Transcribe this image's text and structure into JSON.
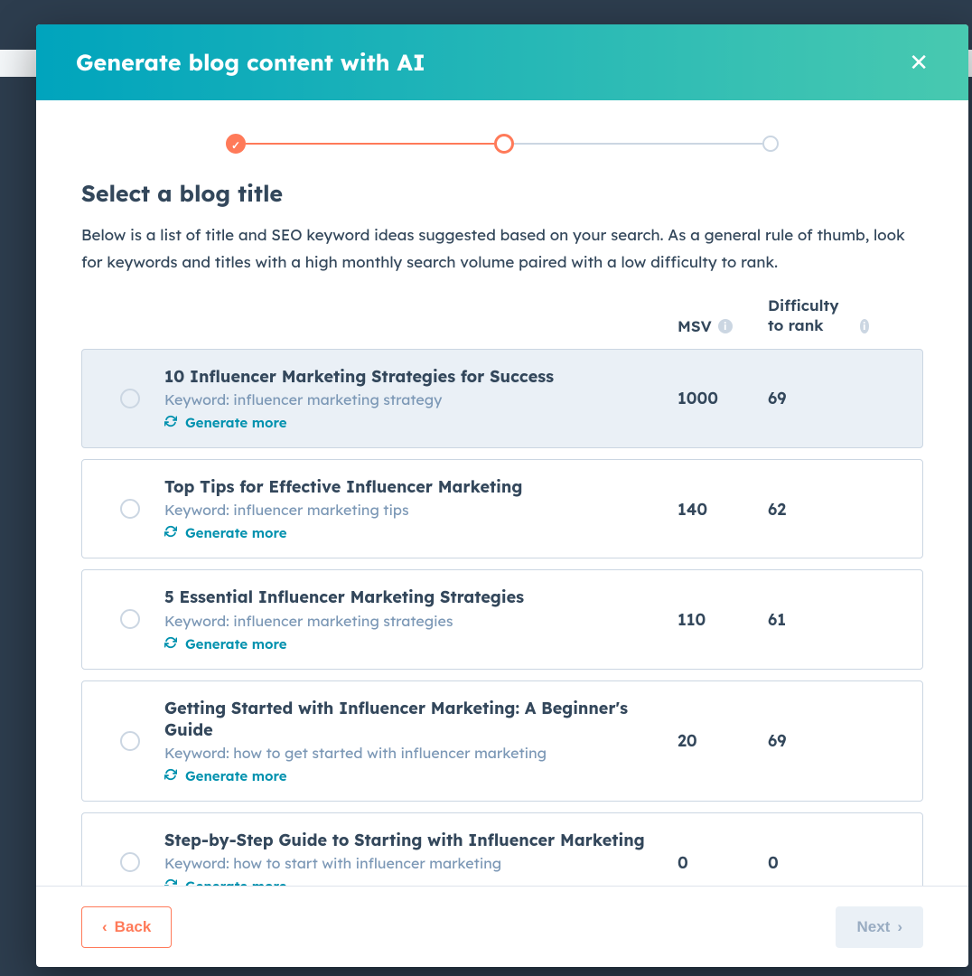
{
  "modal": {
    "title": "Generate blog content with AI",
    "close_icon": "✕"
  },
  "stepper": {
    "completed_check": "✓"
  },
  "section": {
    "title": "Select a blog title",
    "description": "Below is a list of title and SEO keyword ideas suggested based on your search. As a general rule of thumb, look for keywords and titles with a high monthly search volume paired with a low difficulty to rank."
  },
  "headers": {
    "msv": "MSV",
    "difficulty": "Difficulty to rank",
    "info_glyph": "i"
  },
  "keyword_prefix": "Keyword: ",
  "generate_more_label": "Generate more",
  "rows": [
    {
      "title": "10 Influencer Marketing Strategies for Success",
      "keyword": "influencer marketing strategy",
      "msv": "1000",
      "difficulty": "69",
      "highlight": true
    },
    {
      "title": "Top Tips for Effective Influencer Marketing",
      "keyword": "influencer marketing tips",
      "msv": "140",
      "difficulty": "62",
      "highlight": false
    },
    {
      "title": "5 Essential Influencer Marketing Strategies",
      "keyword": "influencer marketing strategies",
      "msv": "110",
      "difficulty": "61",
      "highlight": false
    },
    {
      "title": "Getting Started with Influencer Marketing: A Beginner's Guide",
      "keyword": "how to get started with influencer marketing",
      "msv": "20",
      "difficulty": "69",
      "highlight": false
    },
    {
      "title": "Step-by-Step Guide to Starting with Influencer Marketing",
      "keyword": "how to start with influencer marketing",
      "msv": "0",
      "difficulty": "0",
      "highlight": false
    }
  ],
  "footer": {
    "back": "Back",
    "next": "Next",
    "chev_left": "‹",
    "chev_right": "›"
  }
}
